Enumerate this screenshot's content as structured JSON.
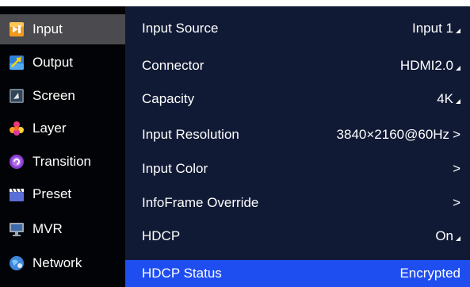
{
  "sidebar": {
    "items": [
      {
        "label": "Input",
        "icon": "input-icon",
        "active": true
      },
      {
        "label": "Output",
        "icon": "output-icon",
        "active": false
      },
      {
        "label": "Screen",
        "icon": "screen-icon",
        "active": false
      },
      {
        "label": "Layer",
        "icon": "layer-icon",
        "active": false
      },
      {
        "label": "Transition",
        "icon": "transition-icon",
        "active": false
      },
      {
        "label": "Preset",
        "icon": "preset-icon",
        "active": false
      },
      {
        "label": "MVR",
        "icon": "mvr-icon",
        "active": false
      },
      {
        "label": "Network",
        "icon": "network-icon",
        "active": false
      }
    ]
  },
  "panel": {
    "rows": [
      {
        "label": "Input Source",
        "value": "Input 1",
        "indicator": "dropdown"
      },
      {
        "label": "Connector",
        "value": "HDMI2.0",
        "indicator": "dropdown"
      },
      {
        "label": "Capacity",
        "value": "4K",
        "indicator": "dropdown"
      },
      {
        "label": "Input Resolution",
        "value": "3840×2160@60Hz",
        "indicator": "submenu"
      },
      {
        "label": "Input Color",
        "value": "",
        "indicator": "submenu"
      },
      {
        "label": "InfoFrame Override",
        "value": "",
        "indicator": "submenu"
      },
      {
        "label": "HDCP",
        "value": "On",
        "indicator": "dropdown"
      },
      {
        "label": "HDCP Status",
        "value": "Encrypted",
        "indicator": "none"
      }
    ]
  },
  "colors": {
    "sidebar_bg": "#020306",
    "sidebar_active": "#4b4b4f",
    "panel_bg": "#101a35",
    "selected_row": "#1f4ef0",
    "text": "#ffffff"
  }
}
